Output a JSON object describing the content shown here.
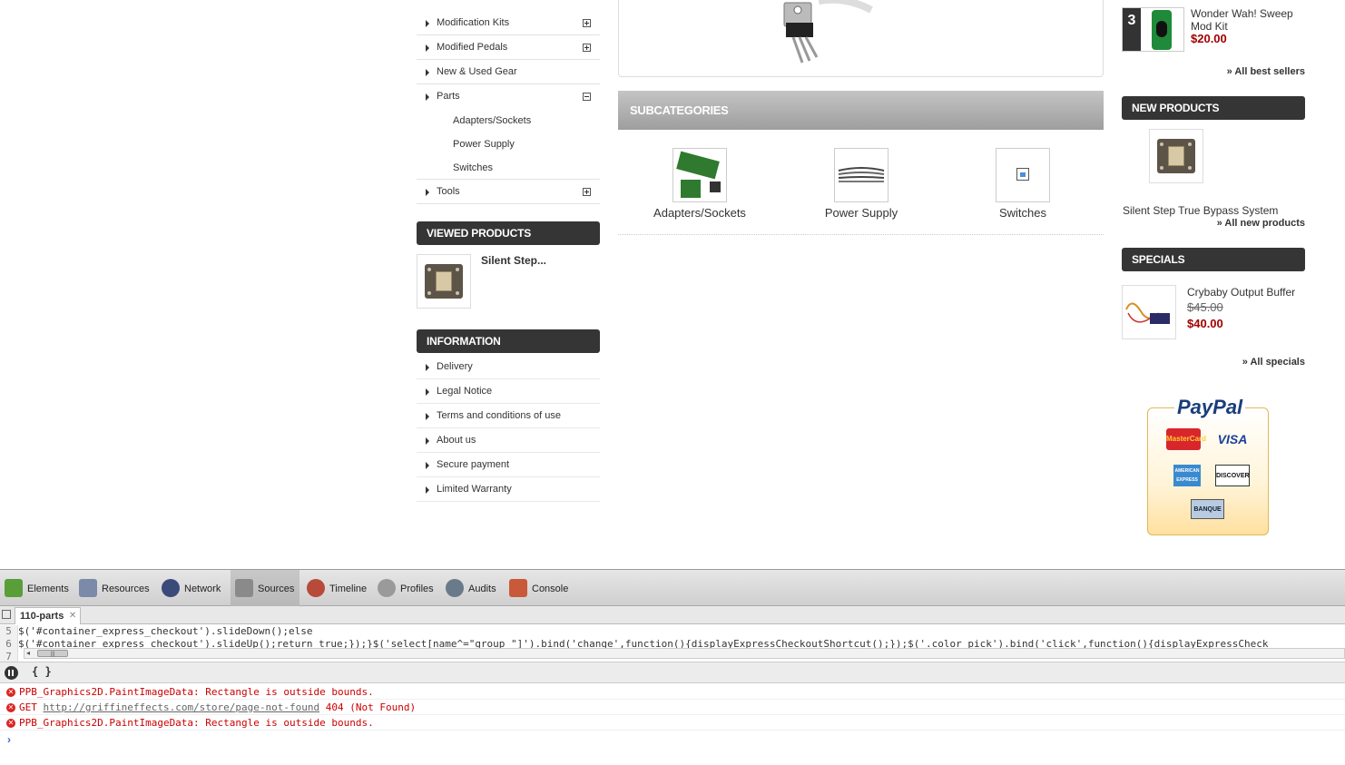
{
  "categories": {
    "items": [
      {
        "label": "Modification Kits",
        "toggle": "plus"
      },
      {
        "label": "Modified Pedals",
        "toggle": "plus"
      },
      {
        "label": "New & Used Gear",
        "toggle": "none"
      },
      {
        "label": "Parts",
        "toggle": "minus"
      }
    ],
    "parts_sub": [
      "Adapters/Sockets",
      "Power Supply",
      "Switches"
    ],
    "tools": {
      "label": "Tools",
      "toggle": "plus"
    }
  },
  "viewed_products": {
    "title": "VIEWED PRODUCTS",
    "item_name": "Silent Step..."
  },
  "information": {
    "title": "INFORMATION",
    "items": [
      "Delivery",
      "Legal Notice",
      "Terms and conditions of use",
      "About us",
      "Secure payment",
      "Limited Warranty"
    ]
  },
  "subcategories": {
    "title": "SUBCATEGORIES",
    "items": [
      "Adapters/Sockets",
      "Power Supply",
      "Switches"
    ]
  },
  "best_sellers": {
    "rank": "3",
    "name_line1": "Wonder Wah! Sweep",
    "name_line2": "Mod Kit",
    "price": "$20.00",
    "all_link": "» All best sellers"
  },
  "new_products": {
    "title": "NEW PRODUCTS",
    "name": "Silent Step True Bypass System",
    "all_link": "» All new products"
  },
  "specials": {
    "title": "SPECIALS",
    "name": "Crybaby Output Buffer",
    "old_price": "$45.00",
    "price": "$40.00",
    "all_link": "» All specials"
  },
  "paypal": {
    "logo": "PayPal",
    "cards": [
      "MasterCard",
      "VISA",
      "AMERICAN EXPRESS",
      "DISCOVER",
      "BANQUE"
    ]
  },
  "devtools": {
    "tabs": [
      "Elements",
      "Resources",
      "Network",
      "Sources",
      "Timeline",
      "Profiles",
      "Audits",
      "Console"
    ],
    "active_tab": "Sources",
    "file_tab": "110-parts",
    "code_lines": [
      {
        "n": "5",
        "text": "$('#container_express_checkout').slideDown();else"
      },
      {
        "n": "6",
        "text": "$('#container_express_checkout').slideUp();return true;});}$('select[name^=\"group_\"]').bind('change',function(){displayExpressCheckoutShortcut();});$('.color_pick').bind('click',function(){displayExpressCheck"
      },
      {
        "n": "7",
        "text": ""
      }
    ],
    "scroll_thumb": "|||",
    "pretty_print": "{ }",
    "messages": [
      {
        "text": "PPB_Graphics2D.PaintImageData: Rectangle is outside bounds."
      },
      {
        "prefix": "GET ",
        "url": "http://griffineffects.com/store/page-not-found",
        "suffix": " 404 (Not Found)"
      },
      {
        "text": "PPB_Graphics2D.PaintImageData: Rectangle is outside bounds."
      }
    ],
    "prompt": "›"
  },
  "colors": {
    "box_title_bg": "#353535",
    "price_red": "#a10000",
    "error_red": "#cc0000"
  }
}
